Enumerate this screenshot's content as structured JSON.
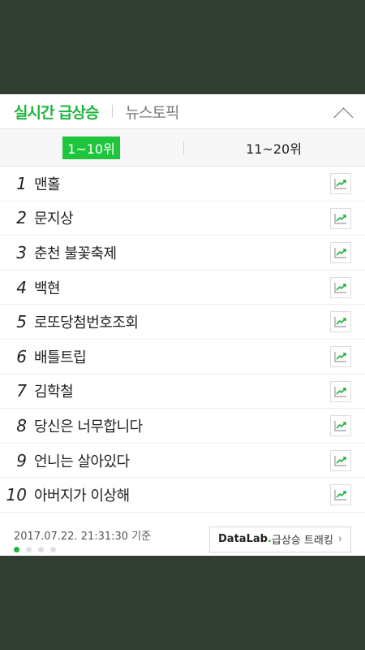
{
  "header": {
    "tab_active": "실시간 급상승",
    "tab_inactive": "뉴스토픽",
    "collapse_icon": "chevron-up-icon"
  },
  "range_tabs": [
    {
      "label": "1~10위",
      "selected": true
    },
    {
      "label": "11~20위",
      "selected": false
    }
  ],
  "keywords": [
    {
      "rank": "1",
      "text": "맨홀"
    },
    {
      "rank": "2",
      "text": "문지상"
    },
    {
      "rank": "3",
      "text": "춘천 불꽃축제"
    },
    {
      "rank": "4",
      "text": "백현"
    },
    {
      "rank": "5",
      "text": "로또당첨번호조회"
    },
    {
      "rank": "6",
      "text": "배틀트립"
    },
    {
      "rank": "7",
      "text": "김학철"
    },
    {
      "rank": "8",
      "text": "당신은 너무합니다"
    },
    {
      "rank": "9",
      "text": "언니는 살아있다"
    },
    {
      "rank": "10",
      "text": "아버지가 이상해"
    }
  ],
  "footer": {
    "timestamp": "2017.07.22. 21:31:30 기준",
    "datalab_brand": "DataLab",
    "datalab_dot": ".",
    "datalab_label": "급상승 트래킹",
    "datalab_chevron": "›",
    "page_count": 4,
    "active_page": 1
  },
  "colors": {
    "accent": "#1eb53f",
    "selected_tab_bg": "#1fc63d",
    "backdrop": "#323d32"
  }
}
